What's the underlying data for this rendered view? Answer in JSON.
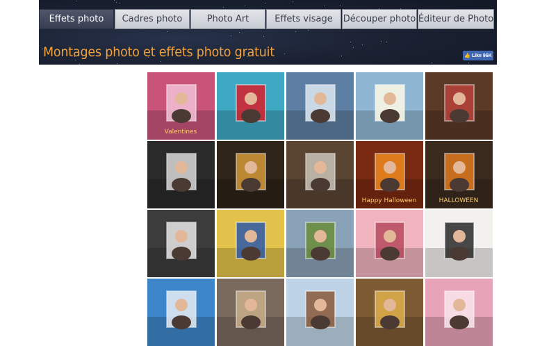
{
  "nav": {
    "tabs": [
      {
        "label": "Effets photo",
        "active": true
      },
      {
        "label": "Cadres photo",
        "active": false
      },
      {
        "label": "Photo Art",
        "active": false
      },
      {
        "label": "Effets visage",
        "active": false
      },
      {
        "label": "Découper photo",
        "active": false
      },
      {
        "label": "Éditeur de Photo",
        "active": false
      }
    ]
  },
  "header": {
    "title": "Montages photo et effets photo gratuit",
    "like_label": "Like 96K"
  },
  "gallery": {
    "tiles": [
      {
        "name": "valentines-effect",
        "bg": "#c9547a",
        "accent": "#f3c2d6",
        "text": "Valentines"
      },
      {
        "name": "roses-gift-frame",
        "bg": "#3fa9c4",
        "accent": "#d81f2a",
        "text": ""
      },
      {
        "name": "winter-frost-frame",
        "bg": "#5d7fa3",
        "accent": "#dfe8f2",
        "text": ""
      },
      {
        "name": "old-photo-on-table",
        "bg": "#8fb7d3",
        "accent": "#fffbe8",
        "text": ""
      },
      {
        "name": "christmas-frame",
        "bg": "#5b3a28",
        "accent": "#b8433a",
        "text": ""
      },
      {
        "name": "pencil-sketch-art",
        "bg": "#2a2a2a",
        "accent": "#d9d9d9",
        "text": ""
      },
      {
        "name": "coffee-table-frame",
        "bg": "#2e2418",
        "accent": "#d69a3a",
        "text": ""
      },
      {
        "name": "vintage-camera-photos",
        "bg": "#5a4432",
        "accent": "#c9c3b6",
        "text": ""
      },
      {
        "name": "happy-halloween-frame",
        "bg": "#7a2a12",
        "accent": "#f08a1e",
        "text": "Happy Halloween"
      },
      {
        "name": "halloween-wall-frame",
        "bg": "#3a2a1e",
        "accent": "#e07a1f",
        "text": "HALLOWEEN"
      },
      {
        "name": "lamp-desk-frame",
        "bg": "#3c3c3c",
        "accent": "#e8e8e8",
        "text": ""
      },
      {
        "name": "pop-art-girl",
        "bg": "#e2c24a",
        "accent": "#2f5aa8",
        "text": ""
      },
      {
        "name": "city-billboard",
        "bg": "#8aa2b8",
        "accent": "#6b8c3a",
        "text": ""
      },
      {
        "name": "pink-flowers-frame",
        "bg": "#f1b4be",
        "accent": "#b84a5e",
        "text": ""
      },
      {
        "name": "tshirt-print",
        "bg": "#f3f1ee",
        "accent": "#2a2a2a",
        "text": ""
      },
      {
        "name": "blue-sky-billboard",
        "bg": "#3d86c9",
        "accent": "#e8eef5",
        "text": ""
      },
      {
        "name": "wooden-frame-wall",
        "bg": "#7a6a5e",
        "accent": "#c9b08a",
        "text": ""
      },
      {
        "name": "light-blue-frame",
        "bg": "#bfd3e6",
        "accent": "#8a5a3a",
        "text": ""
      },
      {
        "name": "sandwich-food",
        "bg": "#7e5b32",
        "accent": "#e0b04a",
        "text": ""
      },
      {
        "name": "pink-curtain-frame",
        "bg": "#e7a3b8",
        "accent": "#fbe7ee",
        "text": ""
      }
    ]
  }
}
